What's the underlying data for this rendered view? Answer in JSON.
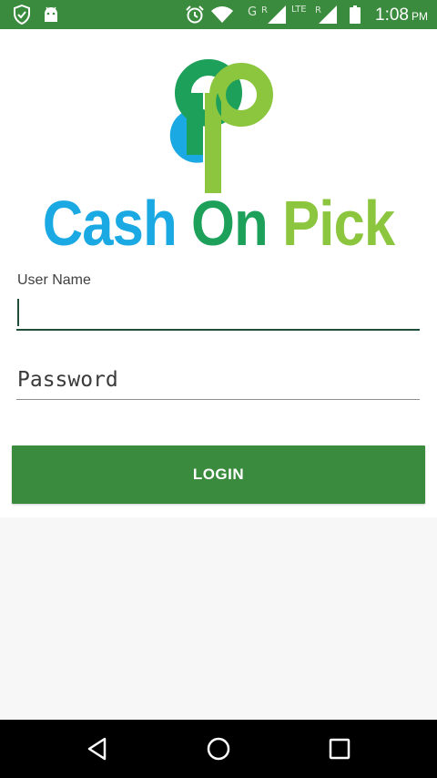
{
  "status_bar": {
    "time": "1:08",
    "ampm": "PM",
    "indicators": [
      "shield-check-icon",
      "android-icon",
      "alarm-icon",
      "wifi-icon",
      "signal-icon",
      "signal-icon",
      "battery-icon"
    ],
    "sim1_label": "G",
    "sim1_roaming": "R",
    "sim2_label": "LTE",
    "sim2_roaming": "R"
  },
  "brand": {
    "word1": "Cash",
    "word2": "On",
    "word3": "Pick",
    "colors": {
      "cash": "#1aa9e2",
      "on": "#1ca05a",
      "pick": "#8cc63f"
    }
  },
  "form": {
    "username_label": "User Name",
    "username_value": "",
    "password_placeholder": "Password",
    "login_label": "LOGIN"
  },
  "theme": {
    "primary": "#3a8b3d",
    "underline_focused": "#1f4f3a"
  },
  "nav_bar": {
    "buttons": [
      "back-icon",
      "home-icon",
      "recents-icon"
    ]
  }
}
